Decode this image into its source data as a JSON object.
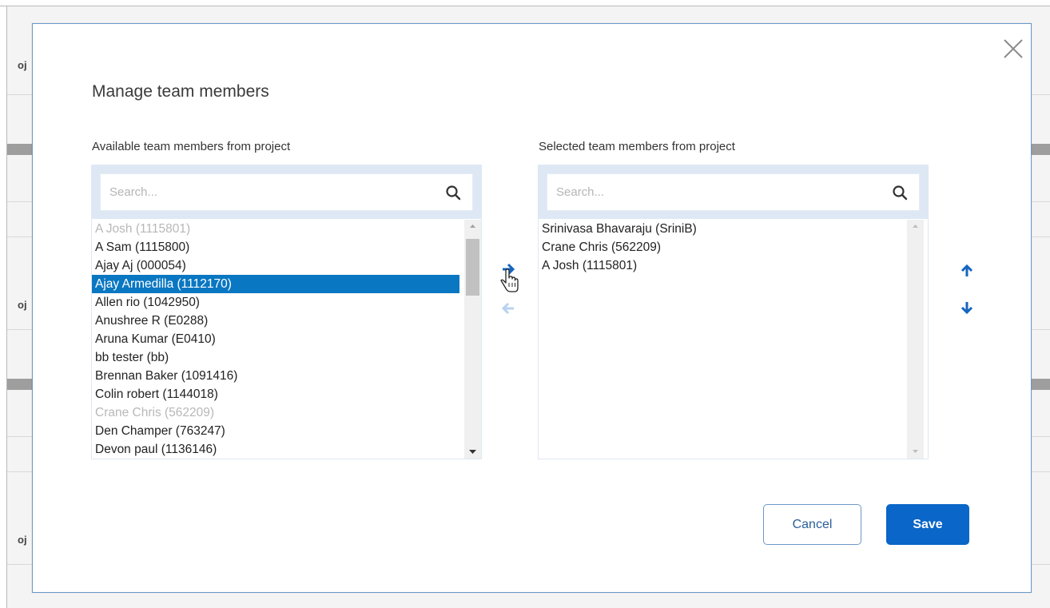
{
  "background": {
    "fragments": [
      "oj",
      "oj",
      "oj"
    ]
  },
  "modal": {
    "title": "Manage team members",
    "close_icon": "close-icon",
    "available": {
      "label": "Available team members from project",
      "search_placeholder": "Search...",
      "search_value": "",
      "items": [
        {
          "text": "A Josh (1115801)",
          "state": "disabled"
        },
        {
          "text": "A Sam (1115800)",
          "state": "normal"
        },
        {
          "text": "Ajay Aj (000054)",
          "state": "normal"
        },
        {
          "text": "Ajay Armedilla (1112170)",
          "state": "selected"
        },
        {
          "text": "Allen rio (1042950)",
          "state": "normal"
        },
        {
          "text": "Anushree R (E0288)",
          "state": "normal"
        },
        {
          "text": "Aruna Kumar (E0410)",
          "state": "normal"
        },
        {
          "text": "bb tester (bb)",
          "state": "normal"
        },
        {
          "text": "Brennan Baker (1091416)",
          "state": "normal"
        },
        {
          "text": "Colin robert (1144018)",
          "state": "normal"
        },
        {
          "text": "Crane Chris (562209)",
          "state": "disabled"
        },
        {
          "text": "Den Champer (763247)",
          "state": "normal"
        },
        {
          "text": "Devon paul (1136146)",
          "state": "normal"
        }
      ]
    },
    "selected": {
      "label": "Selected team members from project",
      "search_placeholder": "Search...",
      "search_value": "",
      "items": [
        {
          "text": "Srinivasa Bhavaraju (SriniB)",
          "state": "normal"
        },
        {
          "text": "Crane Chris (562209)",
          "state": "normal"
        },
        {
          "text": "A Josh (1115801)",
          "state": "normal"
        }
      ]
    },
    "buttons": {
      "cancel": "Cancel",
      "save": "Save"
    },
    "colors": {
      "accent": "#0a66c8",
      "selected_row": "#0a77c2",
      "arrow_active": "#1565c0",
      "arrow_disabled": "#b9d3ef"
    }
  }
}
